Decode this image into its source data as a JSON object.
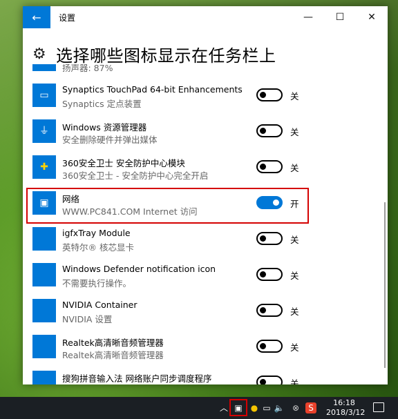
{
  "window": {
    "title": "设置",
    "back_glyph": "←",
    "minimize_glyph": "—",
    "maximize_glyph": "☐",
    "close_glyph": "✕"
  },
  "page": {
    "title": "选择哪些图标显示在任务栏上",
    "icon": "gear-icon"
  },
  "items": [
    {
      "name": "",
      "desc": "扬声器: 87%",
      "state": "",
      "on": false,
      "icon": "speaker-icon"
    },
    {
      "name": "Synaptics TouchPad 64-bit Enhancements",
      "desc": "Synaptics 定点装置",
      "state": "关",
      "on": false,
      "icon": "touchpad-icon"
    },
    {
      "name": "Windows 资源管理器",
      "desc": "安全删除硬件并弹出媒体",
      "state": "关",
      "on": false,
      "icon": "usb-icon"
    },
    {
      "name": "360安全卫士 安全防护中心模块",
      "desc": "360安全卫士 - 安全防护中心完全开启",
      "state": "关",
      "on": false,
      "icon": "360-shield-icon"
    },
    {
      "name": "网络",
      "desc": "WWW.PC841.COM Internet 访问",
      "state": "开",
      "on": true,
      "icon": "network-icon"
    },
    {
      "name": "igfxTray Module",
      "desc": "英特尔® 核芯显卡",
      "state": "关",
      "on": false,
      "icon": "blank-icon"
    },
    {
      "name": "Windows Defender notification icon",
      "desc": "不需要执行操作。",
      "state": "关",
      "on": false,
      "icon": "blank-icon"
    },
    {
      "name": "NVIDIA Container",
      "desc": "NVIDIA 设置",
      "state": "关",
      "on": false,
      "icon": "blank-icon"
    },
    {
      "name": "Realtek高清晰音频管理器",
      "desc": "Realtek高清晰音频管理器",
      "state": "关",
      "on": false,
      "icon": "blank-icon"
    },
    {
      "name": "搜狗拼音输入法 网络账户同步调度程序",
      "desc": "",
      "state": "关",
      "on": false,
      "icon": "blank-icon"
    }
  ],
  "taskbar": {
    "time": "16:18",
    "date": "2018/3/12",
    "tray_icons": [
      "chevron-up-icon",
      "network-icon",
      "360-icon",
      "power-icon",
      "volume-icon",
      "close-circle-icon",
      "sogou-icon"
    ],
    "notification_icon": "action-center-icon"
  }
}
